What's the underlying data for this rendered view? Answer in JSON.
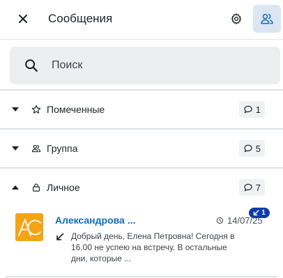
{
  "header": {
    "title": "Сообщения",
    "close_icon": "close-icon",
    "settings_icon": "gear-icon",
    "contacts_icon": "contacts-icon"
  },
  "search": {
    "placeholder": "Поиск",
    "value": ""
  },
  "sections": [
    {
      "label": "Помеченные",
      "icon": "star-icon",
      "count": "1",
      "expanded": false
    },
    {
      "label": "Группа",
      "icon": "users-icon",
      "count": "5",
      "expanded": false
    },
    {
      "label": "Личное",
      "icon": "lock-icon",
      "count": "7",
      "expanded": true
    }
  ],
  "conversation": {
    "name": "Александрова ...",
    "time": "14/07/25",
    "unread": "1",
    "preview": "Добрый день, Елена Петровна! Сегодня в 16.00 не успею на встречу. В остальные дни, которые ...",
    "avatar_bg": "#f5a417"
  },
  "colors": {
    "accent": "#0f6cbf",
    "badge": "#0e3da8",
    "contacts_bg": "#dbe6f3"
  }
}
